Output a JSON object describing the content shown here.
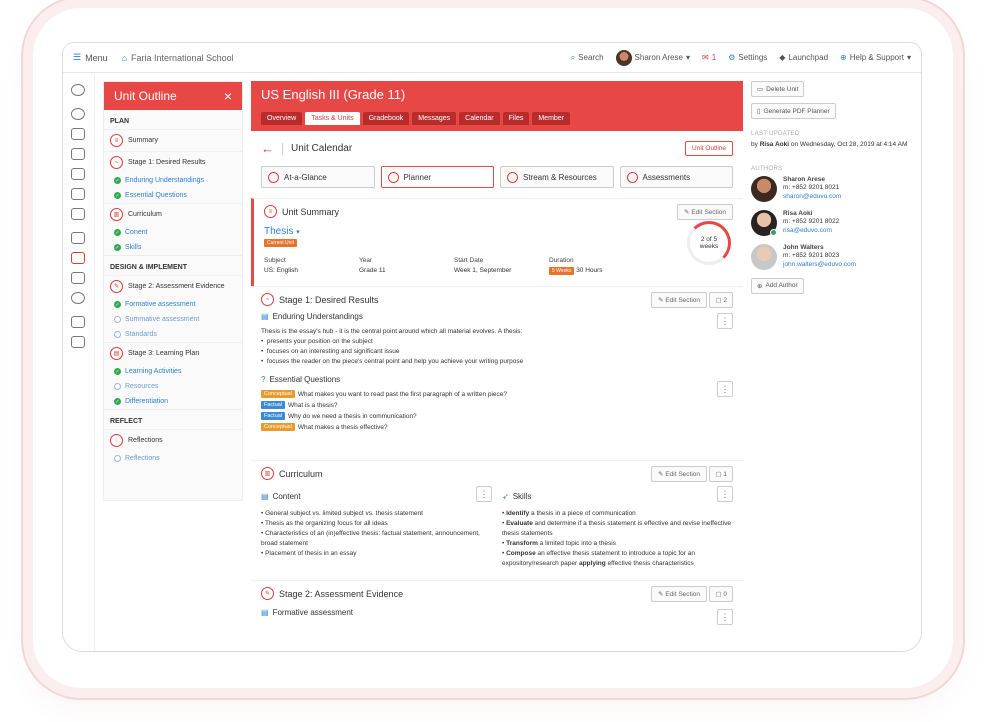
{
  "topbar": {
    "menu": "Menu",
    "school": "Faria International School",
    "search": "Search",
    "user": "Sharon Arese",
    "mail_count": "1",
    "settings": "Settings",
    "launchpad": "Launchpad",
    "help": "Help & Support"
  },
  "outline": {
    "title": "Unit Outline",
    "close": "×",
    "plan": "PLAN",
    "summary": "Summary",
    "stage1": "Stage 1: Desired Results",
    "enduring": "Enduring Understandings",
    "essential": "Essential Questions",
    "curriculum": "Curriculum",
    "conent": "Conent",
    "skills": "Skills",
    "design": "DESIGN & IMPLEMENT",
    "stage2": "Stage 2: Assessment Evidence",
    "formative": "Formative assessment",
    "summative": "Summative assessment",
    "standards": "Standards",
    "stage3": "Stage 3: Learning Plan",
    "learning": "Learning Activities",
    "resources": "Resources",
    "differentiation": "Differentiation",
    "reflect": "REFLECT",
    "reflections_stage": "Reflections",
    "reflections": "Reflections"
  },
  "unit": {
    "title": "US English III (Grade 11)",
    "tabs": [
      "Overview",
      "Tasks & Units",
      "Gradebook",
      "Messages",
      "Calendar",
      "Files",
      "Member"
    ],
    "calendar_title": "Unit Calendar",
    "outline_btn": "Unit Outline",
    "views": [
      "At-a-Glance",
      "Planner",
      "Stream & Resources",
      "Assessments"
    ]
  },
  "summary": {
    "title": "Unit Summary",
    "edit": "Edit Section",
    "thesis": "Thesis",
    "current": "Current Unit",
    "subject_label": "Subject",
    "subject": "US: English",
    "year_label": "Year",
    "year": "Grade 11",
    "start_label": "Start Date",
    "start": "Week 1, September",
    "duration_label": "Duration",
    "weeks_badge": "5 Weeks",
    "hours": "30 Hours",
    "progress_top": "2 of 5",
    "progress_bottom": "weeks",
    "progress_fraction": 0.4
  },
  "stage1": {
    "title": "Stage 1: Desired Results",
    "edit": "Edit Section",
    "comments": "2",
    "enduring": "Enduring Understandings",
    "intro": "Thesis is the essay's hub - it is the central point around which all material evolves. A thesis:",
    "bullets": [
      "presents your position on the subject",
      "focuses on an interesting and significant issue",
      "focuses the reader on the piece's central point and help you achieve your writing purpose"
    ],
    "essential": "Essential Questions",
    "questions": [
      {
        "tag": "Conceptual",
        "text": "What makes you want to read past the first paragraph of a written piece?"
      },
      {
        "tag": "Factual",
        "text": "What is a thesis?"
      },
      {
        "tag": "Factual",
        "text": "Why do we need a thesis in communication?"
      },
      {
        "tag": "Conceptual",
        "text": "What makes a thesis effective?"
      }
    ]
  },
  "curriculum": {
    "title": "Curriculum",
    "edit": "Edit Section",
    "comments": "1",
    "content": "Content",
    "content_items": [
      "General subject vs. limited subject vs. thesis statement",
      "Thesis as the organizing focus for all ideas",
      "Characteristics of an (in)effective thesis: factual statement, announcement, broad statement",
      "Placement of thesis in an essay"
    ],
    "skills": "Skills",
    "skill_items": [
      {
        "b": "Identify",
        "t": " a thesis in a piece of communication"
      },
      {
        "b": "Evaluate",
        "t": " and determine if a thesis statement is effective and revise ineffective thesis statements"
      },
      {
        "b": "Transform",
        "t": " a limited topic into a thesis"
      },
      {
        "b": "Compose",
        "t": " an effective thesis statement to introduce a topic for an expository/research paper ",
        "b2": "applying",
        "t2": " effective thesis characteristics"
      }
    ]
  },
  "stage2": {
    "title": "Stage 2: Assessment Evidence",
    "edit": "Edit Section",
    "comments": "0",
    "formative": "Formative assessment"
  },
  "right": {
    "delete": "Delete Unit",
    "pdf": "Generate PDF Planner",
    "last_updated": "LAST UPDATED",
    "by": "by",
    "updater": "Risa Aoki",
    "updated_rest": " on Wednesday, Oct 28, 2019 at 4:14 AM",
    "authors": "AUTHORS",
    "author_list": [
      {
        "name": "Sharon Arese",
        "phone": "m: +852 9201 8021",
        "email": "sharon@eduvo.com"
      },
      {
        "name": "Risa Aoki",
        "phone": "m: +852 9201 8022",
        "email": "risa@eduvo.com"
      },
      {
        "name": "John Walters",
        "phone": "m: +852 9201 8023",
        "email": "john.walters@eduvo.com"
      }
    ],
    "add_author": "Add Author"
  },
  "colors": {
    "accent": "#e74745",
    "link": "#2d7fd3",
    "success": "#2fa84f"
  }
}
